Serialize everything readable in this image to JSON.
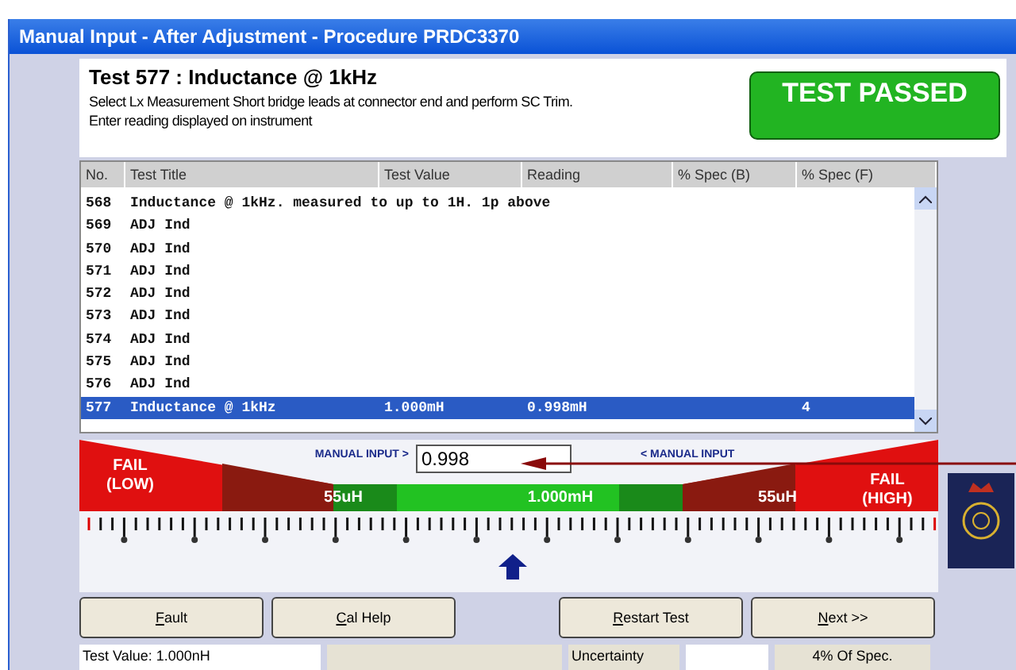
{
  "window": {
    "title": "Manual Input - After Adjustment - Procedure PRDC3370"
  },
  "test": {
    "heading": "Test 577 : Inductance @ 1kHz",
    "instructions": [
      "Select Lx Measurement Short bridge leads at connector end and perform SC Trim.",
      "Enter reading displayed on instrument"
    ]
  },
  "result_badge": {
    "label": "TEST PASSED"
  },
  "table": {
    "columns": [
      "No.",
      "Test Title",
      "Test Value",
      "Reading",
      "% Spec (B)",
      "% Spec (F)"
    ],
    "rows": [
      {
        "cells": [
          "568",
          "Inductance @ 1kHz. measured to up to 1H. 1p above",
          "",
          "",
          "",
          ""
        ],
        "selected": false
      },
      {
        "cells": [
          "569",
          "ADJ Ind",
          "",
          "",
          "",
          ""
        ],
        "selected": false
      },
      {
        "cells": [
          "570",
          "ADJ Ind",
          "",
          "",
          "",
          ""
        ],
        "selected": false
      },
      {
        "cells": [
          "571",
          "ADJ Ind",
          "",
          "",
          "",
          ""
        ],
        "selected": false
      },
      {
        "cells": [
          "572",
          "ADJ Ind",
          "",
          "",
          "",
          ""
        ],
        "selected": false
      },
      {
        "cells": [
          "573",
          "ADJ Ind",
          "",
          "",
          "",
          ""
        ],
        "selected": false
      },
      {
        "cells": [
          "574",
          "ADJ Ind",
          "",
          "",
          "",
          ""
        ],
        "selected": false
      },
      {
        "cells": [
          "575",
          "ADJ Ind",
          "",
          "",
          "",
          ""
        ],
        "selected": false
      },
      {
        "cells": [
          "576",
          "ADJ Ind",
          "",
          "",
          "",
          ""
        ],
        "selected": false
      },
      {
        "cells": [
          "577",
          "Inductance @ 1kHz",
          "1.000mH",
          "0.998mH",
          "",
          "4"
        ],
        "selected": true
      }
    ]
  },
  "gauge": {
    "fail_low": [
      "FAIL",
      "(LOW)"
    ],
    "fail_high": [
      "FAIL",
      "(HIGH)"
    ],
    "input_label_left": "MANUAL INPUT >",
    "input_label_right": "< MANUAL INPUT",
    "input_value": "0.998",
    "tolerance_low": "55uH",
    "nominal": "1.000mH",
    "tolerance_high": "55uH"
  },
  "buttons": [
    {
      "label": "Fault"
    },
    {
      "label": "Cal Help"
    },
    {
      "label": "Restart Test"
    },
    {
      "label": "Next >>"
    }
  ],
  "status_bar": {
    "test_value": "Test Value: 1.000nH",
    "uncertainty_label": "Uncertainty",
    "spec": "4% Of Spec."
  }
}
